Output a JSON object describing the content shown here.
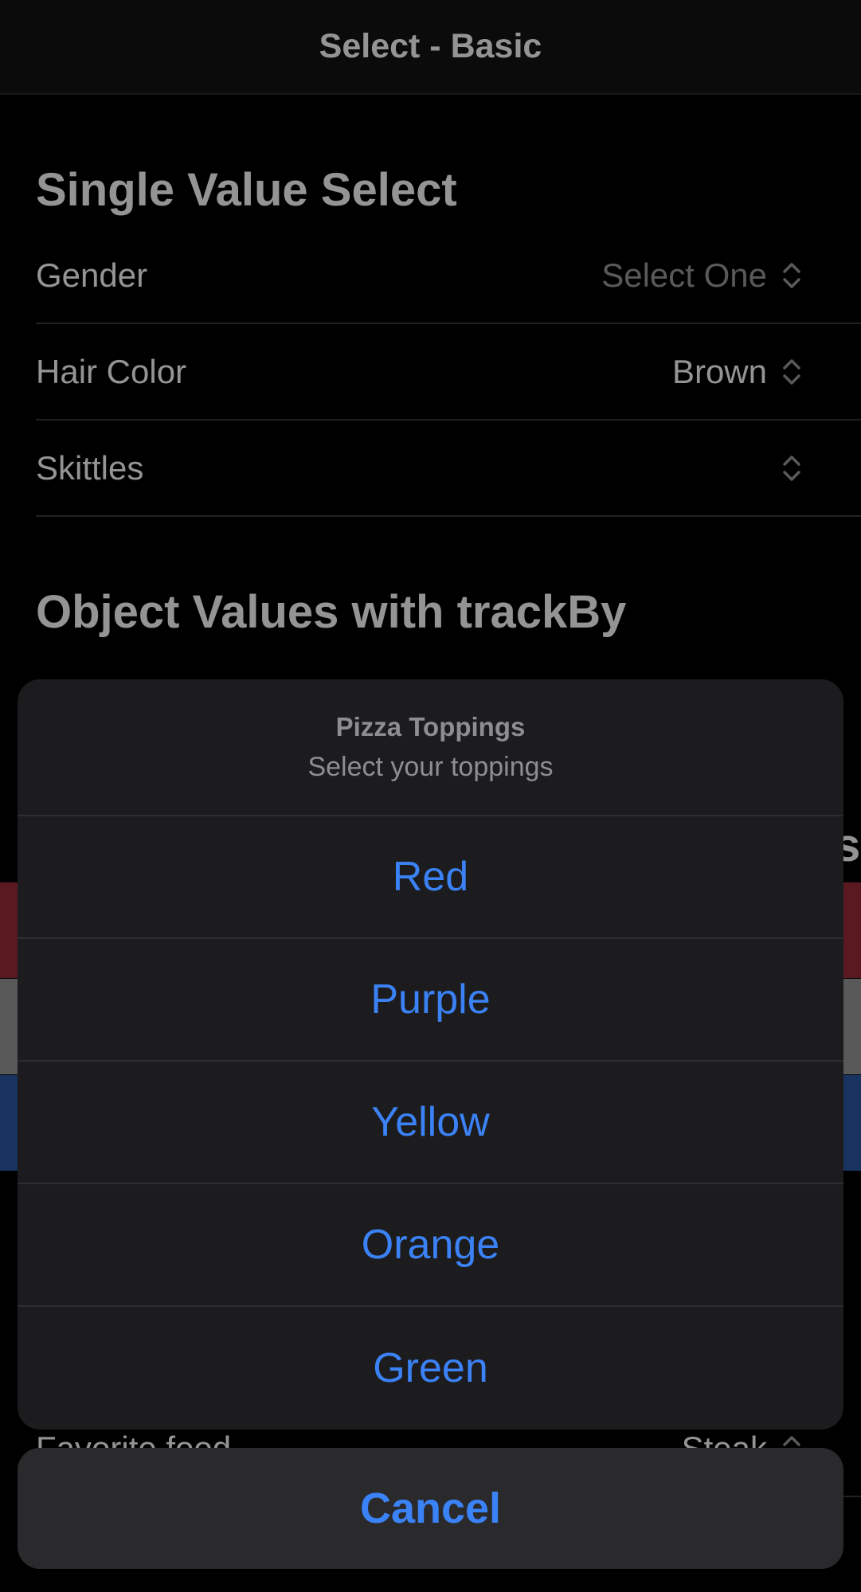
{
  "navbar": {
    "title": "Select - Basic"
  },
  "sections": {
    "single": {
      "header": "Single Value Select",
      "rows": [
        {
          "label": "Gender",
          "value": "Select One"
        },
        {
          "label": "Hair Color",
          "value": "Brown"
        },
        {
          "label": "Skittles",
          "value": ""
        }
      ]
    },
    "object": {
      "header": "Object Values with trackBy"
    },
    "hidden_header_fragment": "s",
    "bottom_row": {
      "label": "Favorite food",
      "value": "Steak"
    }
  },
  "colors": {
    "band_red": "#9c2a3a",
    "band_gray": "#9a9a9a",
    "band_blue": "#2c58a6",
    "accent_blue": "#3b82f6"
  },
  "action_sheet": {
    "title": "Pizza Toppings",
    "subtitle": "Select your toppings",
    "options": [
      "Red",
      "Purple",
      "Yellow",
      "Orange",
      "Green"
    ],
    "cancel_label": "Cancel"
  },
  "icons": {
    "row_chevron": "chevron-up-down-icon"
  }
}
